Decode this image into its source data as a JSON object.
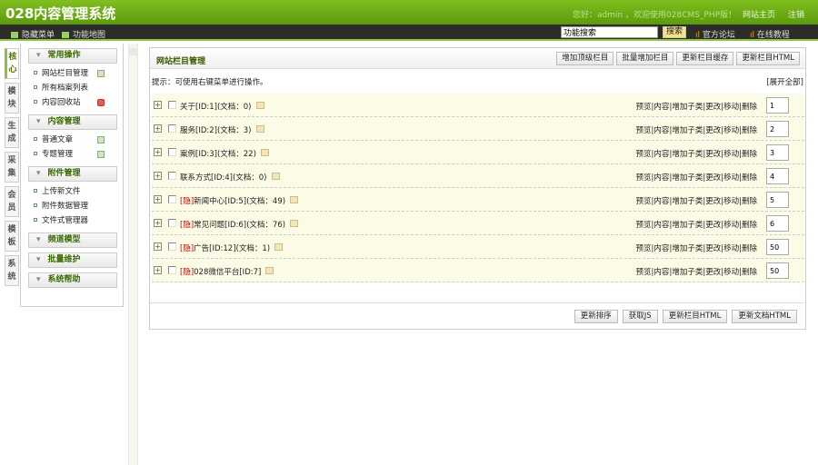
{
  "header": {
    "title": "028内容管理系统",
    "welcome": "您好：admin ，欢迎使用028CMS_PHP版！",
    "home_link": "网站主页",
    "logout_link": "注销"
  },
  "toolbar": {
    "hide_menu": "隐藏菜单",
    "function_map": "功能地图",
    "search_value": "功能搜索",
    "search_button": "搜索",
    "forum": "官方论坛",
    "tutorial": "在线教程"
  },
  "tabs": [
    "核心",
    "模块",
    "生成",
    "采集",
    "会员",
    "模板",
    "系统"
  ],
  "sidebar": {
    "groups": [
      {
        "label": "常用操作",
        "items": [
          {
            "label": "网站栏目管理",
            "icon": "add"
          },
          {
            "label": "所有档案列表"
          },
          {
            "label": "内容回收站",
            "icon": "recycle"
          }
        ]
      },
      {
        "label": "内容管理",
        "items": [
          {
            "label": "普通文章",
            "icon": "add"
          },
          {
            "label": "专题管理",
            "icon": "add"
          }
        ]
      },
      {
        "label": "附件管理",
        "items": [
          {
            "label": "上传新文件"
          },
          {
            "label": "附件数据管理"
          },
          {
            "label": "文件式管理器"
          }
        ]
      },
      {
        "label": "频道模型",
        "items": []
      },
      {
        "label": "批量维护",
        "items": []
      },
      {
        "label": "系统帮助",
        "items": []
      }
    ]
  },
  "main": {
    "title": "网站栏目管理",
    "buttons": [
      "增加顶级栏目",
      "批量增加栏目",
      "更新栏目缓存",
      "更新栏目HTML"
    ],
    "tip": "提示：可使用右键菜单进行操作。",
    "expand_all": "[展开全部]",
    "ops": [
      "预览",
      "内容",
      "增加子类",
      "更改",
      "移动",
      "删除"
    ],
    "rows": [
      {
        "hidden": "",
        "name": "关于[ID:1](文档：0)",
        "order": "1"
      },
      {
        "hidden": "",
        "name": "服务[ID:2](文档：3)",
        "order": "2"
      },
      {
        "hidden": "",
        "name": "案例[ID:3](文档：22)",
        "order": "3"
      },
      {
        "hidden": "",
        "name": "联系方式[ID:4](文档：0)",
        "order": "4"
      },
      {
        "hidden": "[隐]",
        "name": "新闻中心[ID:5](文档：49)",
        "order": "5"
      },
      {
        "hidden": "[隐]",
        "name": "常见问题[ID:6](文档：76)",
        "order": "6"
      },
      {
        "hidden": "[隐]",
        "name": "广告[ID:12](文档：1)",
        "order": "50"
      },
      {
        "hidden": "[隐]",
        "name": "028微信平台[ID:7]",
        "order": "50"
      }
    ],
    "footer_buttons": [
      "更新排序",
      "获取JS",
      "更新栏目HTML",
      "更新文档HTML"
    ]
  }
}
